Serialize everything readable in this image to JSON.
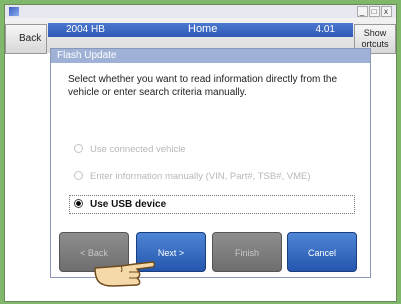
{
  "window": {
    "vehicle": "2004 HB",
    "title": "Home",
    "version": "4.01",
    "back_label": "Back",
    "shortcuts_label": "Show\nortcuts",
    "controls": [
      "_",
      "□",
      "x"
    ]
  },
  "dialog": {
    "title": "Flash Update",
    "prompt": "Select whether you want to read information directly from the vehicle or enter search criteria manually.",
    "options": [
      {
        "label": "Use connected vehicle",
        "selected": false,
        "enabled": false
      },
      {
        "label": "Enter information manually (VIN, Part#, TSB#, VME)",
        "selected": false,
        "enabled": false
      },
      {
        "label": "Use USB device",
        "selected": true,
        "enabled": true
      }
    ],
    "buttons": {
      "back": "< Back",
      "next": "Next >",
      "finish": "Finish",
      "cancel": "Cancel"
    }
  },
  "colors": {
    "background": "#7fb86a",
    "accent_blue": "#2f59b4",
    "disabled_button": "#7a7a7a"
  }
}
